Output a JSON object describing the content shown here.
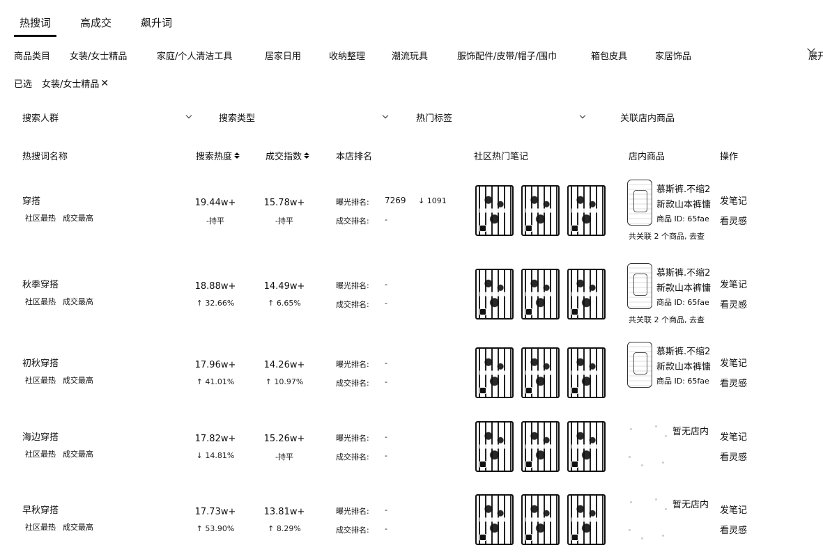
{
  "tabs": [
    {
      "label": "热搜词",
      "active": true
    },
    {
      "label": "高成交",
      "active": false
    },
    {
      "label": "飙升词",
      "active": false
    }
  ],
  "categories": {
    "label": "商品类目",
    "items": [
      "女装/女士精品",
      "家庭/个人清洁工具",
      "居家日用",
      "收纳整理",
      "潮流玩具",
      "服饰配件/皮带/帽子/围巾",
      "箱包皮具",
      "家居饰品"
    ],
    "expand_label": "展开"
  },
  "selected": {
    "label": "已选",
    "tag": "女装/女士精品"
  },
  "filters": {
    "audience": "搜索人群",
    "search_type": "搜索类型",
    "hot_tags": "热门标签",
    "linked_products": "关联店内商品"
  },
  "headers": {
    "keyword": "热搜词名称",
    "search_heat": "搜索热度",
    "deal_index": "成交指数",
    "store_rank": "本店排名",
    "community_notes": "社区热门笔记",
    "store_products": "店内商品",
    "actions": "操作"
  },
  "rank_labels": {
    "exposure": "曝光排名:",
    "deal": "成交排名:"
  },
  "badges": [
    "社区最热",
    "成交最高"
  ],
  "actions": {
    "post_note": "发笔记",
    "inspiration": "看灵感"
  },
  "rows": [
    {
      "keyword": "穿搭",
      "search_heat": "19.44w+",
      "search_trend": "-持平",
      "deal_index": "15.78w+",
      "deal_trend": "-持平",
      "exposure_rank": "7269",
      "exposure_delta": "↓ 1091",
      "deal_rank": "-",
      "product": {
        "has_product": true,
        "name_line1": "慕斯裤.不缩2",
        "name_line2": "新款山本裤慵",
        "id": "商品 ID: 65fae",
        "assoc": "共关联 2 个商品, 去查"
      }
    },
    {
      "keyword": "秋季穿搭",
      "search_heat": "18.88w+",
      "search_trend": "↑ 32.66%",
      "deal_index": "14.49w+",
      "deal_trend": "↑ 6.65%",
      "exposure_rank": "-",
      "exposure_delta": "",
      "deal_rank": "-",
      "product": {
        "has_product": true,
        "name_line1": "慕斯裤.不缩2",
        "name_line2": "新款山本裤慵",
        "id": "商品 ID: 65fae",
        "assoc": "共关联 2 个商品, 去查"
      }
    },
    {
      "keyword": "初秋穿搭",
      "search_heat": "17.96w+",
      "search_trend": "↑ 41.01%",
      "deal_index": "14.26w+",
      "deal_trend": "↑ 10.97%",
      "exposure_rank": "-",
      "exposure_delta": "",
      "deal_rank": "-",
      "product": {
        "has_product": true,
        "name_line1": "慕斯裤.不缩2",
        "name_line2": "新款山本裤慵",
        "id": "商品 ID: 65fae",
        "assoc": ""
      }
    },
    {
      "keyword": "海边穿搭",
      "search_heat": "17.82w+",
      "search_trend": "↓ 14.81%",
      "deal_index": "15.26w+",
      "deal_trend": "-持平",
      "exposure_rank": "-",
      "exposure_delta": "",
      "deal_rank": "-",
      "product": {
        "has_product": false,
        "empty_label": "暂无店内"
      }
    },
    {
      "keyword": "早秋穿搭",
      "search_heat": "17.73w+",
      "search_trend": "↑ 53.90%",
      "deal_index": "13.81w+",
      "deal_trend": "↑ 8.29%",
      "exposure_rank": "-",
      "exposure_delta": "",
      "deal_rank": "-",
      "product": {
        "has_product": false,
        "empty_label": "暂无店内"
      }
    }
  ]
}
